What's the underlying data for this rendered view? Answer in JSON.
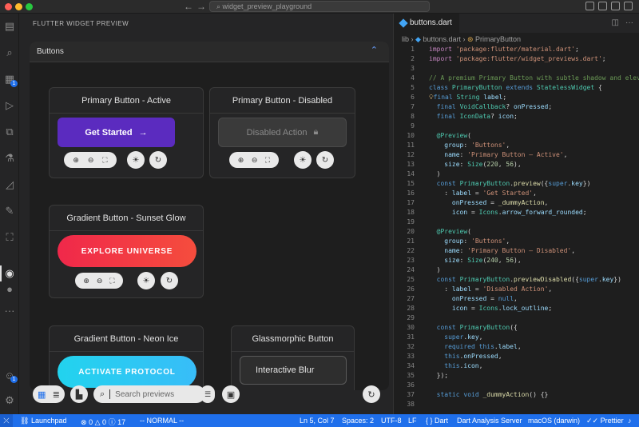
{
  "titlebar": {
    "search_text": "widget_preview_playground"
  },
  "preview": {
    "panel_title": "FLUTTER WIDGET PREVIEW",
    "group_label": "Buttons",
    "cards": [
      {
        "title": "Primary Button - Active",
        "button_label": "Get Started"
      },
      {
        "title": "Primary Button - Disabled",
        "button_label": "Disabled Action"
      },
      {
        "title": "Gradient Button - Sunset Glow",
        "button_label": "EXPLORE UNIVERSE"
      },
      {
        "title": "Gradient Button - Neon Ice",
        "button_label": "ACTIVATE PROTOCOL"
      },
      {
        "title": "Glassmorphic Button",
        "button_label": "Interactive Blur"
      }
    ],
    "search_placeholder": "Search previews"
  },
  "activity_badges": {
    "extensions": "1",
    "account": "1"
  },
  "editor": {
    "tab_label": "buttons.dart",
    "breadcrumb": {
      "folder": "lib",
      "file": "buttons.dart",
      "symbol": "PrimaryButton"
    }
  },
  "statusbar": {
    "branch": "Launchpad",
    "errors": "0",
    "warnings": "0",
    "info": "17",
    "mode": "-- NORMAL --",
    "position": "Ln 5, Col 7",
    "spaces": "Spaces: 2",
    "encoding": "UTF-8",
    "eol": "LF",
    "language": "Dart",
    "server": "Dart Analysis Server",
    "platform": "macOS (darwin)",
    "formatter": "Prettier"
  },
  "colors": {
    "accent": "#1f6feb",
    "primary_button": "#5b2bbf",
    "sunset_start": "#f0284a",
    "sunset_end": "#f54d3d",
    "neon_start": "#22d3ee",
    "neon_end": "#38bdf8"
  }
}
